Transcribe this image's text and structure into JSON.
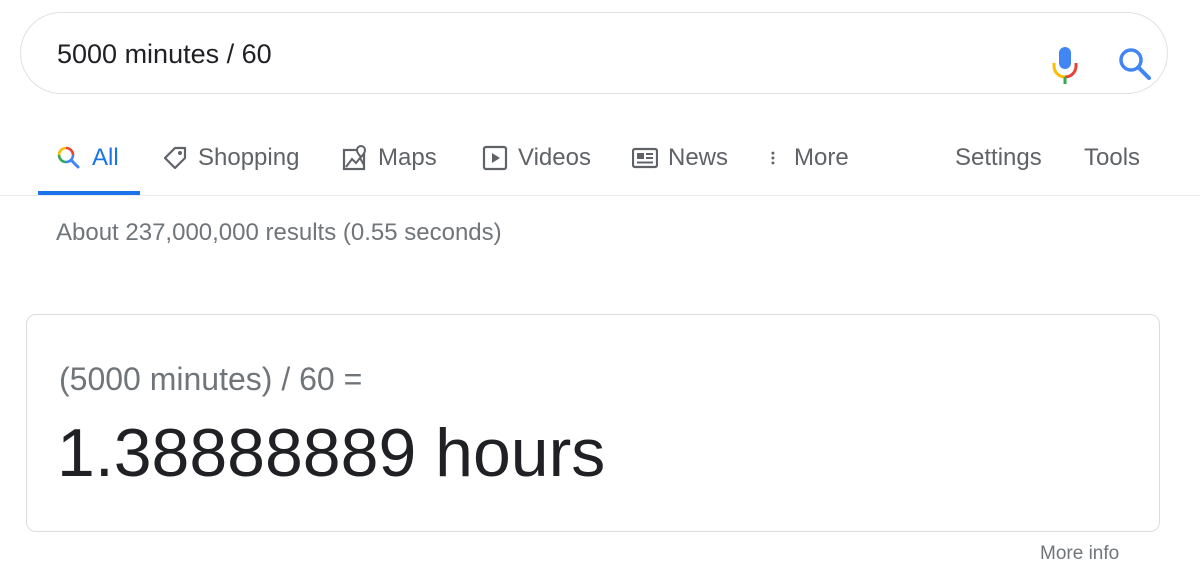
{
  "search": {
    "query": "5000 minutes / 60"
  },
  "tabs": [
    {
      "label": "All",
      "icon": "google-search-icon",
      "active": true
    },
    {
      "label": "Shopping",
      "icon": "tag-icon"
    },
    {
      "label": "Maps",
      "icon": "map-pin-icon"
    },
    {
      "label": "Videos",
      "icon": "play-icon"
    },
    {
      "label": "News",
      "icon": "newspaper-icon"
    },
    {
      "label": "More",
      "icon": "vertical-dots-icon"
    }
  ],
  "tools": {
    "settings_label": "Settings",
    "tools_label": "Tools"
  },
  "stats": {
    "text": "About 237,000,000 results (0.55 seconds)"
  },
  "calculator": {
    "expression": "(5000 minutes) / 60 =",
    "result": "1.38888889 hours"
  },
  "footer": {
    "more_info": "More info"
  },
  "colors": {
    "accent": "#1a73e8",
    "text": "#202124",
    "muted": "#70757a",
    "mic_blue": "#4285f4",
    "mic_red": "#ea4335",
    "mic_yellow": "#fbbc05",
    "mic_green": "#34a853"
  }
}
